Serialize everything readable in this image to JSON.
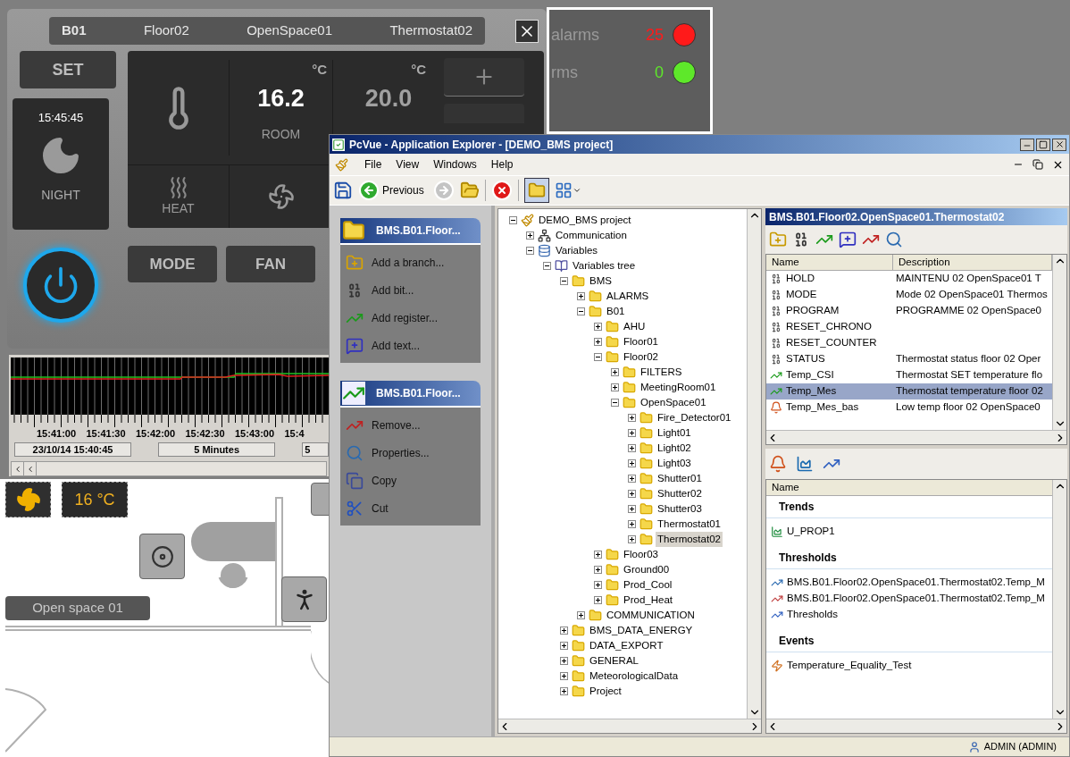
{
  "thermostat": {
    "path": [
      "B01",
      "Floor02",
      "OpenSpace01",
      "Thermostat02"
    ],
    "set_button": "SET",
    "clock": "15:45:45",
    "mode_label": "NIGHT",
    "power_on": true,
    "room": {
      "unit": "°C",
      "value": "16.2",
      "label": "ROOM"
    },
    "setpoint": {
      "unit": "°C",
      "value": "20.0"
    },
    "heat_label": "HEAT",
    "buttons": [
      "MODE",
      "FAN"
    ]
  },
  "alarms": [
    {
      "label": "alarms",
      "count": "25",
      "color": "#ff1a1a"
    },
    {
      "label": "rms",
      "count": "0",
      "color": "#5ee82a"
    }
  ],
  "trend": {
    "time_labels": [
      "15:41:00",
      "15:41:30",
      "15:42:00",
      "15:42:30",
      "15:43:00",
      "15:4"
    ],
    "footer": [
      "23/10/14 15:40:45",
      "5 Minutes",
      "5"
    ]
  },
  "floor_plan": {
    "temperature": "16 °C",
    "zone_label": "Open space 01"
  },
  "explorer": {
    "title": "PcVue - Application Explorer - [DEMO_BMS project]",
    "menu": [
      "File",
      "View",
      "Windows",
      "Help"
    ],
    "toolbar": {
      "back_label": "Previous",
      "forward_disabled": true,
      "folders_pressed": true
    },
    "task_groups": [
      {
        "title": "BMS.B01.Floor...",
        "kind": "folder",
        "items": [
          {
            "label": "Add a branch...",
            "kind": "add-folder"
          },
          {
            "label": "Add bit...",
            "kind": "add-bit"
          },
          {
            "label": "Add register...",
            "kind": "add-register"
          },
          {
            "label": "Add text...",
            "kind": "add-text"
          }
        ]
      },
      {
        "title": "BMS.B01.Floor...",
        "kind": "register",
        "items": [
          {
            "label": "Remove...",
            "kind": "remove"
          },
          {
            "label": "Properties...",
            "kind": "properties"
          },
          {
            "label": "Copy",
            "kind": "copy"
          },
          {
            "label": "Cut",
            "kind": "cut"
          }
        ]
      }
    ],
    "tree": [
      {
        "label": "DEMO_BMS project",
        "kind": "project",
        "expanded": true,
        "selected": false,
        "children": [
          {
            "label": "Communication",
            "kind": "communication",
            "expanded": false,
            "selected": false
          },
          {
            "label": "Variables",
            "kind": "variables",
            "expanded": true,
            "selected": false,
            "children": [
              {
                "label": "Variables tree",
                "kind": "book",
                "expanded": true,
                "selected": false,
                "children": [
                  {
                    "label": "BMS",
                    "kind": "folder",
                    "expanded": true,
                    "selected": false,
                    "children": [
                      {
                        "label": "ALARMS",
                        "kind": "folder",
                        "expanded": false,
                        "selected": false
                      },
                      {
                        "label": "B01",
                        "kind": "folder",
                        "expanded": true,
                        "selected": false,
                        "children": [
                          {
                            "label": "AHU",
                            "kind": "folder",
                            "expanded": false,
                            "selected": false
                          },
                          {
                            "label": "Floor01",
                            "kind": "folder",
                            "expanded": false,
                            "selected": false
                          },
                          {
                            "label": "Floor02",
                            "kind": "folder",
                            "expanded": true,
                            "selected": false,
                            "children": [
                              {
                                "label": "FILTERS",
                                "kind": "folder",
                                "expanded": false,
                                "selected": false
                              },
                              {
                                "label": "MeetingRoom01",
                                "kind": "folder",
                                "expanded": false,
                                "selected": false
                              },
                              {
                                "label": "OpenSpace01",
                                "kind": "folder",
                                "expanded": true,
                                "selected": false,
                                "children": [
                                  {
                                    "label": "Fire_Detector01",
                                    "kind": "folder",
                                    "expanded": false,
                                    "selected": false
                                  },
                                  {
                                    "label": "Light01",
                                    "kind": "folder",
                                    "expanded": false,
                                    "selected": false
                                  },
                                  {
                                    "label": "Light02",
                                    "kind": "folder",
                                    "expanded": false,
                                    "selected": false
                                  },
                                  {
                                    "label": "Light03",
                                    "kind": "folder",
                                    "expanded": false,
                                    "selected": false
                                  },
                                  {
                                    "label": "Shutter01",
                                    "kind": "folder",
                                    "expanded": false,
                                    "selected": false
                                  },
                                  {
                                    "label": "Shutter02",
                                    "kind": "folder",
                                    "expanded": false,
                                    "selected": false
                                  },
                                  {
                                    "label": "Shutter03",
                                    "kind": "folder",
                                    "expanded": false,
                                    "selected": false
                                  },
                                  {
                                    "label": "Thermostat01",
                                    "kind": "folder",
                                    "expanded": false,
                                    "selected": false
                                  },
                                  {
                                    "label": "Thermostat02",
                                    "kind": "folder",
                                    "expanded": false,
                                    "selected": true
                                  }
                                ]
                              }
                            ]
                          },
                          {
                            "label": "Floor03",
                            "kind": "folder",
                            "expanded": false,
                            "selected": false
                          },
                          {
                            "label": "Ground00",
                            "kind": "folder",
                            "expanded": false,
                            "selected": false
                          },
                          {
                            "label": "Prod_Cool",
                            "kind": "folder",
                            "expanded": false,
                            "selected": false
                          },
                          {
                            "label": "Prod_Heat",
                            "kind": "folder",
                            "expanded": false,
                            "selected": false
                          }
                        ]
                      },
                      {
                        "label": "COMMUNICATION",
                        "kind": "folder",
                        "expanded": false,
                        "selected": false
                      }
                    ]
                  },
                  {
                    "label": "BMS_DATA_ENERGY",
                    "kind": "folder",
                    "expanded": false,
                    "selected": false
                  },
                  {
                    "label": "DATA_EXPORT",
                    "kind": "folder",
                    "expanded": false,
                    "selected": false
                  },
                  {
                    "label": "GENERAL",
                    "kind": "folder",
                    "expanded": false,
                    "selected": false
                  },
                  {
                    "label": "MeteorologicalData",
                    "kind": "folder",
                    "expanded": false,
                    "selected": false
                  },
                  {
                    "label": "Project",
                    "kind": "folder",
                    "expanded": false,
                    "selected": false
                  }
                ]
              }
            ]
          }
        ]
      }
    ],
    "detail": {
      "title": "BMS.B01.Floor02.OpenSpace01.Thermostat02",
      "columns": [
        "Name",
        "Description"
      ],
      "rows": [
        {
          "name": "HOLD",
          "description": "MAINTENU  02  OpenSpace01 T",
          "kind": "bit",
          "selected": false
        },
        {
          "name": "MODE",
          "description": "Mode 02 OpenSpace01 Thermos",
          "kind": "bit",
          "selected": false
        },
        {
          "name": "PROGRAM",
          "description": "PROGRAMME  02  OpenSpace0",
          "kind": "bit",
          "selected": false
        },
        {
          "name": "RESET_CHRONO",
          "kind": "bit",
          "selected": false
        },
        {
          "name": "RESET_COUNTER",
          "kind": "bit",
          "selected": false
        },
        {
          "name": "STATUS",
          "description": "Thermostat status floor 02 Oper",
          "kind": "bit",
          "selected": false
        },
        {
          "name": "Temp_CSI",
          "description": "Thermostat SET temperature flo",
          "kind": "register",
          "selected": false
        },
        {
          "name": "Temp_Mes",
          "description": "Thermostat temperature floor 02",
          "kind": "register",
          "selected": true
        },
        {
          "name": "Temp_Mes_bas",
          "description": "Low temp floor 02 OpenSpace0",
          "kind": "alarm",
          "selected": false
        }
      ],
      "list_column": "Name",
      "sections": [
        {
          "title": "Trends",
          "items": [
            {
              "label": "U_PROP1",
              "kind": "trend"
            }
          ]
        },
        {
          "title": "Thresholds",
          "items": [
            {
              "label": "BMS.B01.Floor02.OpenSpace01.Thermostat02.Temp_M",
              "kind": "threshold-low"
            },
            {
              "label": "BMS.B01.Floor02.OpenSpace01.Thermostat02.Temp_M",
              "kind": "threshold-high"
            },
            {
              "label": "Thresholds",
              "kind": "thresholds"
            }
          ]
        },
        {
          "title": "Events",
          "items": [
            {
              "label": "Temperature_Equality_Test",
              "kind": "event"
            }
          ]
        }
      ]
    },
    "status_user": "ADMIN (ADMIN)"
  }
}
